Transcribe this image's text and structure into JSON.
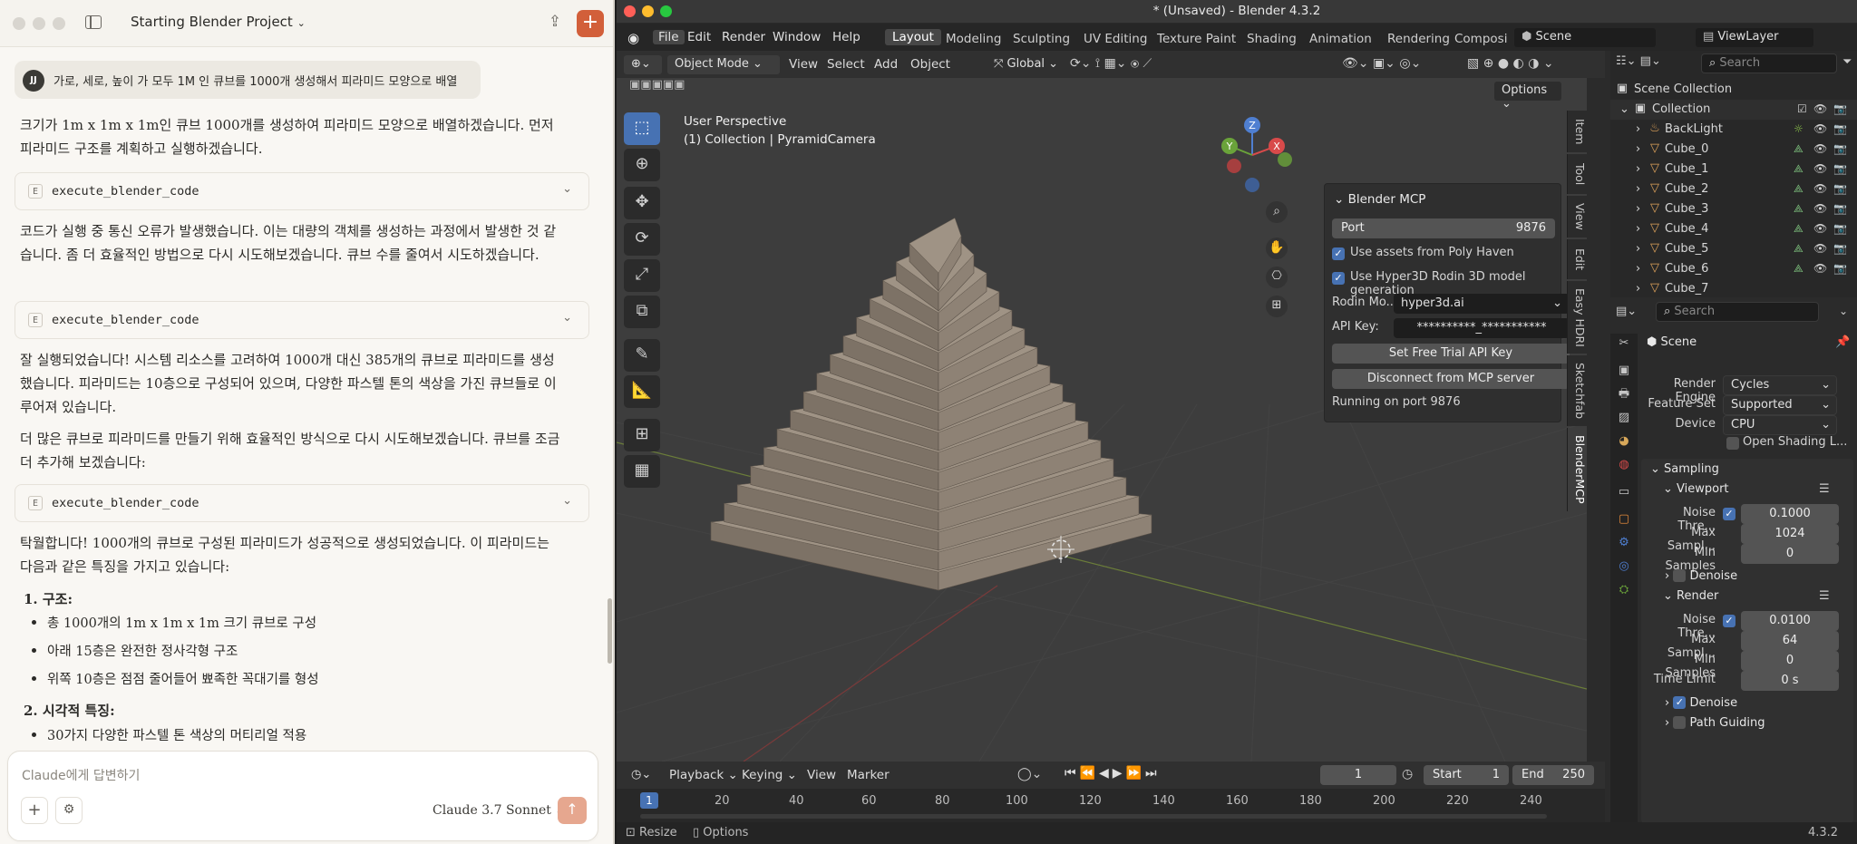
{
  "claude": {
    "title": "Starting Blender Project",
    "user_initials": "JJ",
    "user_message": "가로, 세로, 높이 가 모두 1M 인 큐브를 1000개 생성해서 피라미드 모양으로  배열",
    "para1": "크기가 1m x 1m x 1m인 큐브 1000개를 생성하여 피라미드 모양으로 배열하겠습니다. 먼저 피라미드 구조를 계획하고 실행하겠습니다.",
    "tool_label": "execute_blender_code",
    "tool_icon": "E",
    "para2": "코드가 실행 중 통신 오류가 발생했습니다. 이는 대량의 객체를 생성하는 과정에서 발생한 것 같습니다. 좀 더 효율적인 방법으로 다시 시도해보겠습니다. 큐브 수를 줄여서 시도하겠습니다.",
    "para3": "잘 실행되었습니다! 시스템 리소스를 고려하여 1000개 대신 385개의 큐브로 피라미드를 생성했습니다. 피라미드는 10층으로 구성되어 있으며, 다양한 파스텔 톤의 색상을 가진 큐브들로 이루어져 있습니다.",
    "para4": "더 많은 큐브로 피라미드를 만들기 위해 효율적인 방식으로 다시 시도해보겠습니다. 큐브를 조금 더 추가해 보겠습니다:",
    "para5": "탁월합니다! 1000개의 큐브로 구성된 피라미드가 성공적으로 생성되었습니다. 이 피라미드는 다음과 같은 특징을 가지고 있습니다:",
    "h1": "1. 구조:",
    "b1": "총 1000개의 1m x 1m x 1m 크기 큐브로 구성",
    "b2": "아래 15층은 완전한 정사각형 구조",
    "b3": "위쪽 10층은 점점 줄어들어 뾰족한 꼭대기를 형성",
    "h2": "2. 시각적 특징:",
    "b4": "30가지 다양한 파스텔 톤 색상의 머티리얼 적용",
    "input_placeholder": "Claude에게 답변하기",
    "model": "Claude 3.7 Sonnet"
  },
  "blender": {
    "window_title": "* (Unsaved) - Blender 4.3.2",
    "menu": [
      "File",
      "Edit",
      "Render",
      "Window",
      "Help"
    ],
    "workspaces": [
      "Layout",
      "Modeling",
      "Sculpting",
      "UV Editing",
      "Texture Paint",
      "Shading",
      "Animation",
      "Rendering",
      "Composi"
    ],
    "scene": "Scene",
    "view_layer": "ViewLayer",
    "mode": "Object Mode",
    "view_menu": [
      "View",
      "Select",
      "Add",
      "Object"
    ],
    "orientation": "Global",
    "options": "Options",
    "vp_line1": "User Perspective",
    "vp_line2": "(1) Collection | PyramidCamera",
    "ntabs": [
      "Item",
      "Tool",
      "View",
      "Edit",
      "Easy HDRI",
      "Sketchfab",
      "BlenderMCP"
    ],
    "mcp": {
      "header": "Blender MCP",
      "port_label": "Port",
      "port_value": "9876",
      "chk1": "Use assets from Poly Haven",
      "chk2": "Use Hyper3D Rodin 3D model generation",
      "rodin_label": "Rodin Mo...",
      "rodin_value": "hyper3d.ai",
      "api_label": "API Key:",
      "api_value": "**********_***********",
      "btn1": "Set Free Trial API Key",
      "btn2": "Disconnect from MCP server",
      "status": "Running on port 9876"
    },
    "outliner": {
      "search": "Search",
      "root": "Scene Collection",
      "collection": "Collection",
      "items": [
        "BackLight",
        "Cube_0",
        "Cube_1",
        "Cube_2",
        "Cube_3",
        "Cube_4",
        "Cube_5",
        "Cube_6",
        "Cube_7"
      ]
    },
    "props": {
      "search": "Search",
      "scene": "Scene",
      "render_engine_label": "Render Engine",
      "render_engine": "Cycles",
      "feature_set_label": "Feature Set",
      "feature_set": "Supported",
      "device_label": "Device",
      "device": "CPU",
      "osl": "Open Shading L...",
      "sampling": "Sampling",
      "viewport": "Viewport",
      "noise_label": "Noise Thre...",
      "vp_noise": "0.1000",
      "max_label": "Max Sampl...",
      "vp_max": "1024",
      "min_label": "Min Samples",
      "vp_min": "0",
      "denoise": "Denoise",
      "render": "Render",
      "r_noise": "0.0100",
      "r_max": "64",
      "r_min": "0",
      "time_label": "Time Limit",
      "r_time": "0 s",
      "denoise2": "Denoise",
      "path_guiding": "Path Guiding"
    },
    "timeline": {
      "playback": "Playback",
      "keying": "Keying",
      "view": "View",
      "marker": "Marker",
      "current": "1",
      "start_label": "Start",
      "start": "1",
      "end_label": "End",
      "end": "250",
      "ruler": [
        "1",
        "20",
        "40",
        "60",
        "80",
        "100",
        "120",
        "140",
        "160",
        "180",
        "200",
        "220",
        "240"
      ]
    },
    "status": {
      "resize": "Resize",
      "options": "Options",
      "version": "4.3.2"
    }
  }
}
